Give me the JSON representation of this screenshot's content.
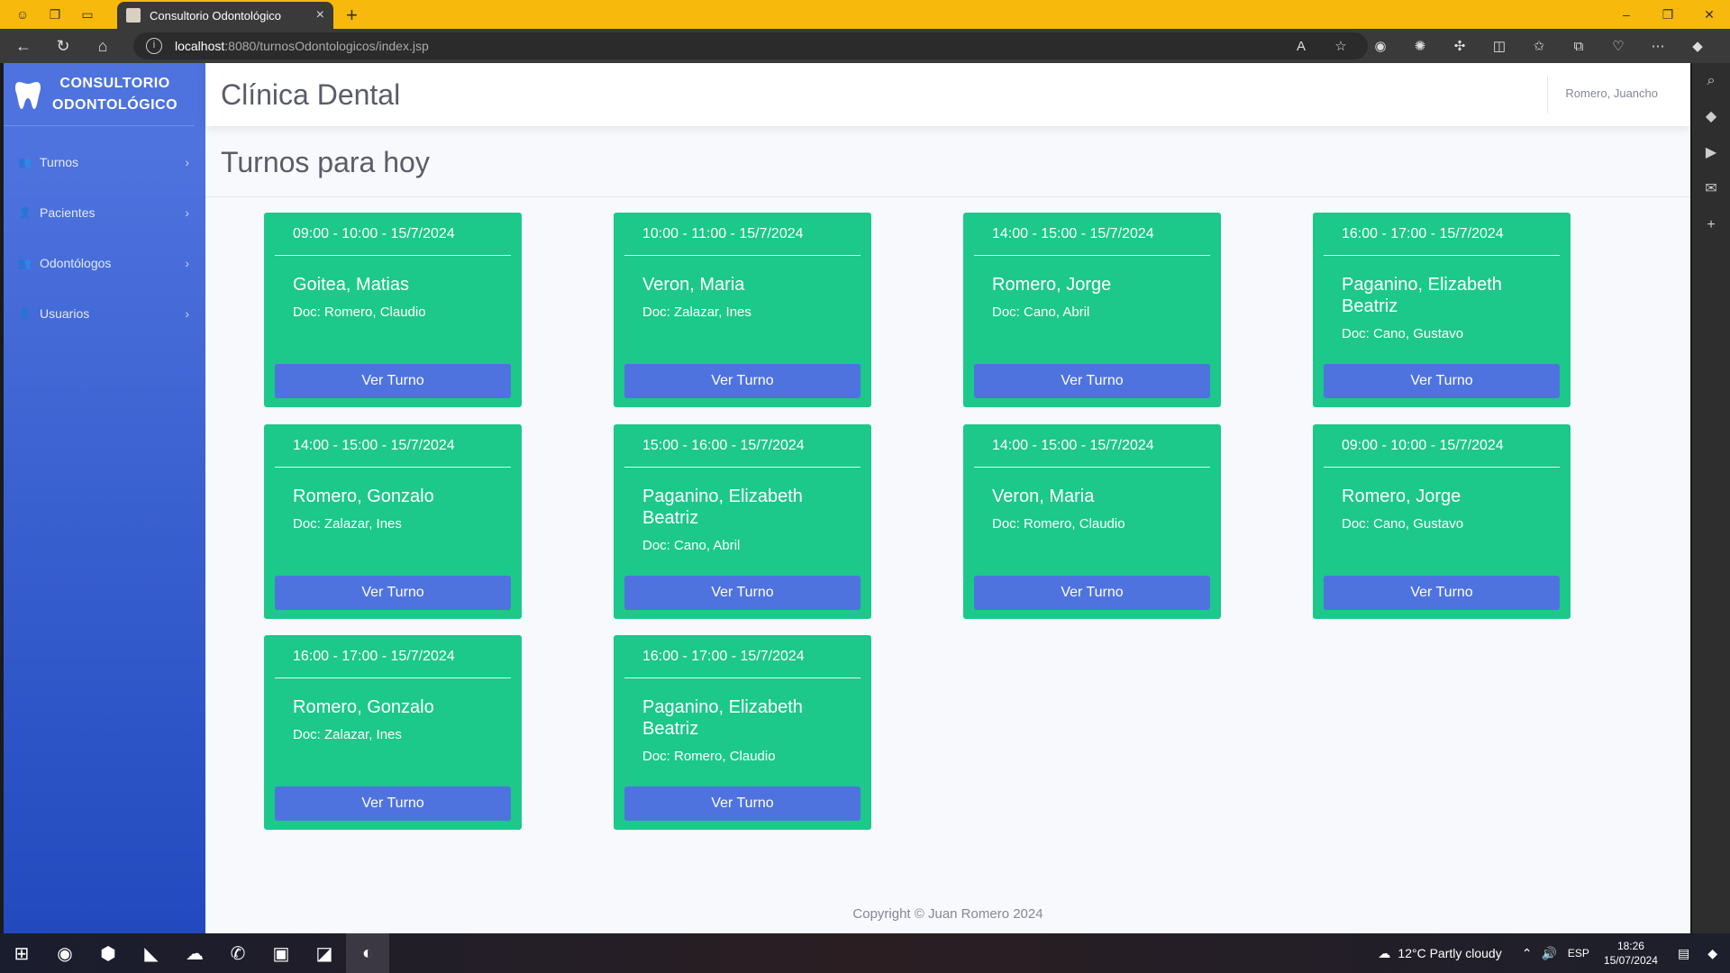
{
  "browser": {
    "tab_title": "Consultorio Odontológico",
    "url_host": "localhost",
    "url_path": ":8080/turnosOdontologicos/index.jsp"
  },
  "sidebar": {
    "brand_line1": "CONSULTORIO",
    "brand_line2": "ODONTOLÓGICO",
    "items": [
      {
        "label": "Turnos"
      },
      {
        "label": "Pacientes"
      },
      {
        "label": "Odontólogos"
      },
      {
        "label": "Usuarios"
      }
    ]
  },
  "topbar": {
    "title": "Clínica Dental",
    "user": "Romero, Juancho"
  },
  "main": {
    "heading": "Turnos para hoy",
    "button_label": "Ver Turno",
    "cards": [
      {
        "time": "09:00 - 10:00 - 15/7/2024",
        "patient": "Goitea, Matias",
        "doctor": "Doc: Romero, Claudio"
      },
      {
        "time": "10:00 - 11:00 - 15/7/2024",
        "patient": "Veron, Maria",
        "doctor": "Doc: Zalazar, Ines"
      },
      {
        "time": "14:00 - 15:00 - 15/7/2024",
        "patient": "Romero, Jorge",
        "doctor": "Doc: Cano, Abril"
      },
      {
        "time": "16:00 - 17:00 - 15/7/2024",
        "patient": "Paganino, Elizabeth Beatriz",
        "doctor": "Doc: Cano, Gustavo"
      },
      {
        "time": "14:00 - 15:00 - 15/7/2024",
        "patient": "Romero, Gonzalo",
        "doctor": "Doc: Zalazar, Ines"
      },
      {
        "time": "15:00 - 16:00 - 15/7/2024",
        "patient": "Paganino, Elizabeth Beatriz",
        "doctor": "Doc: Cano, Abril"
      },
      {
        "time": "14:00 - 15:00 - 15/7/2024",
        "patient": "Veron, Maria",
        "doctor": "Doc: Romero, Claudio"
      },
      {
        "time": "09:00 - 10:00 - 15/7/2024",
        "patient": "Romero, Jorge",
        "doctor": "Doc: Cano, Gustavo"
      },
      {
        "time": "16:00 - 17:00 - 15/7/2024",
        "patient": "Romero, Gonzalo",
        "doctor": "Doc: Zalazar, Ines"
      },
      {
        "time": "16:00 - 17:00 - 15/7/2024",
        "patient": "Paganino, Elizabeth Beatriz",
        "doctor": "Doc: Romero, Claudio"
      }
    ]
  },
  "footer": {
    "text": "Copyright © Juan Romero 2024"
  },
  "taskbar": {
    "weather": "12°C  Partly cloudy",
    "lang": "ESP",
    "time": "18:26",
    "date": "15/07/2024"
  },
  "colors": {
    "card": "#1cc88a",
    "button": "#4e73df",
    "sidebar": "#4e73df",
    "titlebar": "#f6b90c"
  }
}
